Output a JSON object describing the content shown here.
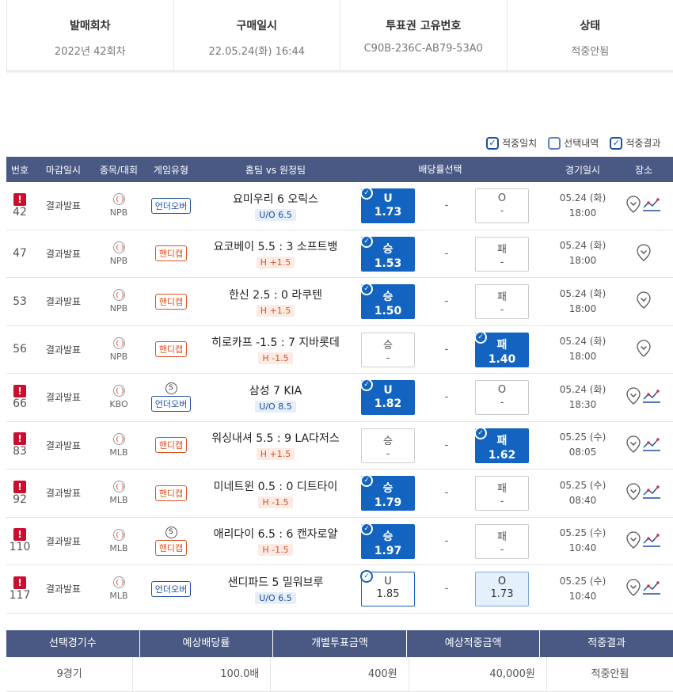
{
  "summary": {
    "round_label": "발매회차",
    "round_value": "2022년 42회차",
    "purchase_label": "구매일시",
    "purchase_value": "22.05.24(화) 16:44",
    "ticket_label": "투표권 고유번호",
    "ticket_value": "C90B-236C-AB79-53A0",
    "status_label": "상태",
    "status_value": "적중안됨"
  },
  "legend": {
    "hit_match": "적중일치",
    "selection": "선택내역",
    "hit_result": "적중결과"
  },
  "table": {
    "headers": {
      "no": "번호",
      "close": "마감일시",
      "sport": "종목/대회",
      "type": "게임유형",
      "match": "홈팀 vs 원정팀",
      "odds": "배당률선택",
      "date": "경기일시",
      "loc": "장소"
    },
    "rows": [
      {
        "no": "42",
        "alert": true,
        "close": "결과발표",
        "league": "NPB",
        "special": "",
        "type": "언더오버",
        "type_kind": "ou",
        "match": "요미우리   6   오릭스",
        "sub": "U/O 6.5",
        "left_label": "U",
        "left_val": "1.73",
        "left_state": "sel",
        "mid": "-",
        "right_label": "O",
        "right_val": "-",
        "right_state": "none",
        "date": "05.24 (화)",
        "time": "18:00",
        "trend": true
      },
      {
        "no": "47",
        "alert": false,
        "close": "결과발표",
        "league": "NPB",
        "special": "",
        "type": "핸디캡",
        "type_kind": "hc",
        "match": "요코베이 5.5 : 3 소프트뱅",
        "sub": "H +1.5",
        "left_label": "승",
        "left_val": "1.53",
        "left_state": "sel",
        "mid": "-",
        "right_label": "패",
        "right_val": "-",
        "right_state": "none",
        "date": "05.24 (화)",
        "time": "18:00",
        "trend": false
      },
      {
        "no": "53",
        "alert": false,
        "close": "결과발표",
        "league": "NPB",
        "special": "",
        "type": "핸디캡",
        "type_kind": "hc",
        "match": "한신 2.5 : 0 라쿠텐",
        "sub": "H +1.5",
        "left_label": "승",
        "left_val": "1.50",
        "left_state": "sel",
        "mid": "-",
        "right_label": "패",
        "right_val": "-",
        "right_state": "none",
        "date": "05.24 (화)",
        "time": "18:00",
        "trend": false
      },
      {
        "no": "56",
        "alert": false,
        "close": "결과발표",
        "league": "NPB",
        "special": "",
        "type": "핸디캡",
        "type_kind": "hc",
        "match": "히로카프 -1.5 : 7 지바롯데",
        "sub": "H -1.5",
        "left_label": "승",
        "left_val": "-",
        "left_state": "none",
        "mid": "-",
        "right_label": "패",
        "right_val": "1.40",
        "right_state": "sel",
        "date": "05.24 (화)",
        "time": "18:00",
        "trend": false
      },
      {
        "no": "66",
        "alert": true,
        "close": "결과발표",
        "league": "KBO",
        "special": "S",
        "type": "언더오버",
        "type_kind": "ou",
        "match": "삼성    7    KIA",
        "sub": "U/O 8.5",
        "left_label": "U",
        "left_val": "1.82",
        "left_state": "sel",
        "mid": "-",
        "right_label": "O",
        "right_val": "-",
        "right_state": "none",
        "date": "05.24 (화)",
        "time": "18:30",
        "trend": true
      },
      {
        "no": "83",
        "alert": true,
        "close": "결과발표",
        "league": "MLB",
        "special": "",
        "type": "핸디캡",
        "type_kind": "hc",
        "match": "워싱내셔 5.5 : 9 LA다저스",
        "sub": "H +1.5",
        "left_label": "승",
        "left_val": "-",
        "left_state": "none",
        "mid": "-",
        "right_label": "패",
        "right_val": "1.62",
        "right_state": "sel",
        "date": "05.25 (수)",
        "time": "08:05",
        "trend": true
      },
      {
        "no": "92",
        "alert": true,
        "close": "결과발표",
        "league": "MLB",
        "special": "",
        "type": "핸디캡",
        "type_kind": "hc",
        "match": "미네트윈 0.5 : 0 디트타이",
        "sub": "H -1.5",
        "left_label": "승",
        "left_val": "1.79",
        "left_state": "sel",
        "mid": "-",
        "right_label": "패",
        "right_val": "-",
        "right_state": "none",
        "date": "05.25 (수)",
        "time": "08:40",
        "trend": true
      },
      {
        "no": "110",
        "alert": true,
        "close": "결과발표",
        "league": "MLB",
        "special": "S",
        "type": "핸디캡",
        "type_kind": "hc",
        "match": "애리다이 6.5 : 6 캔자로얄",
        "sub": "H -1.5",
        "left_label": "승",
        "left_val": "1.97",
        "left_state": "sel",
        "mid": "-",
        "right_label": "패",
        "right_val": "-",
        "right_state": "none",
        "date": "05.25 (수)",
        "time": "10:40",
        "trend": true
      },
      {
        "no": "117",
        "alert": true,
        "close": "결과발표",
        "league": "MLB",
        "special": "",
        "type": "언더오버",
        "type_kind": "ou",
        "match": "샌디파드    5    밀워브루",
        "sub": "U/O 6.5",
        "left_label": "U",
        "left_val": "1.85",
        "left_state": "picked",
        "mid": "-",
        "right_label": "O",
        "right_val": "1.73",
        "right_state": "lightsel",
        "date": "05.25 (수)",
        "time": "10:40",
        "trend": true
      }
    ]
  },
  "footer": {
    "headers": [
      "선택경기수",
      "예상배당률",
      "개별투표금액",
      "예상적중금액",
      "적중결과"
    ],
    "values": [
      "9경기",
      "100.0배",
      "400원",
      "40,000원",
      "적중안됨"
    ]
  },
  "colors": {
    "header_bg": "#4a5983",
    "selected_blue": "#1264c0",
    "alert_red": "#c8102e",
    "handicap_orange": "#d9531e"
  }
}
